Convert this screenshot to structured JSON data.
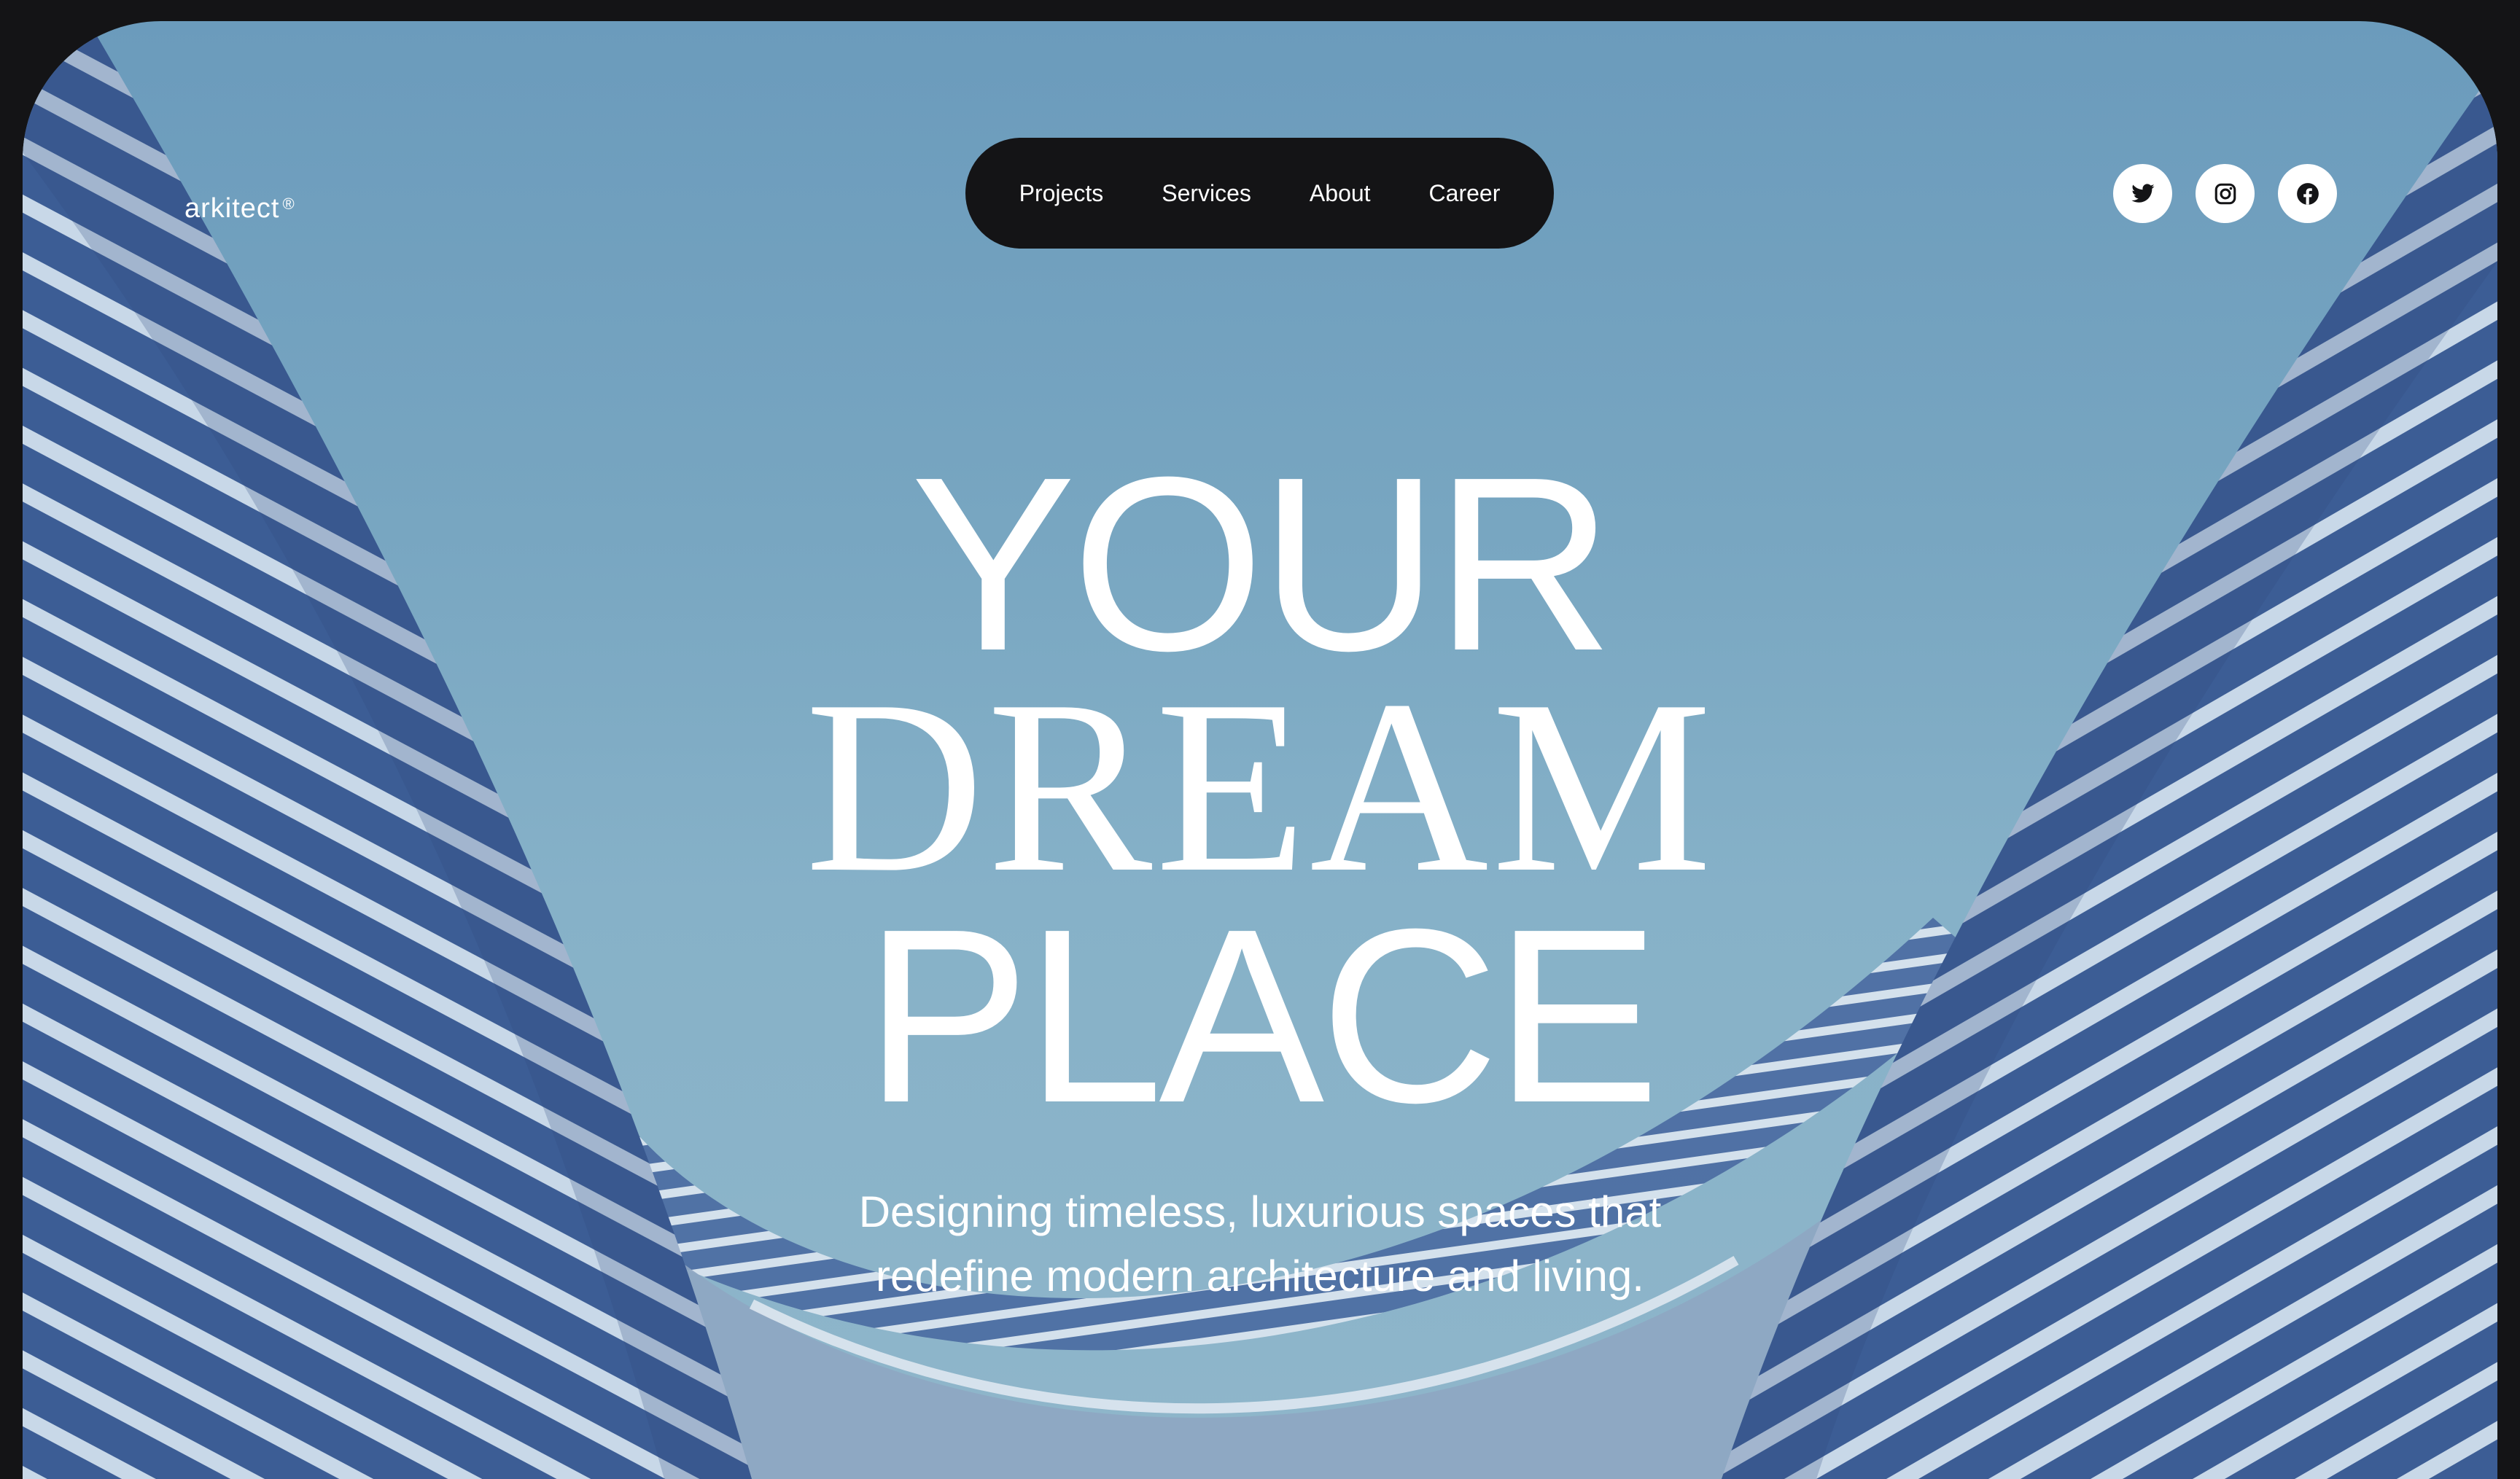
{
  "brand": {
    "name": "arkitect",
    "mark": "®"
  },
  "nav": {
    "items": [
      {
        "label": "Projects"
      },
      {
        "label": "Services"
      },
      {
        "label": "About"
      },
      {
        "label": "Career"
      }
    ]
  },
  "socials": {
    "items": [
      {
        "icon": "twitter-icon"
      },
      {
        "icon": "instagram-icon"
      },
      {
        "icon": "facebook-icon"
      }
    ]
  },
  "hero": {
    "line1": "YOUR",
    "line2": "DREAM",
    "line3": "PLACE",
    "tagline_line1": "Designing timeless, luxurious spaces that",
    "tagline_line2": "redefine modern architecture and living."
  },
  "colors": {
    "page_bg": "#141416",
    "sky": "#7aa7c2",
    "building_dark": "#3f5f93",
    "building_light": "#c9d9e8",
    "nav_bg": "#141416",
    "text": "#ffffff"
  }
}
